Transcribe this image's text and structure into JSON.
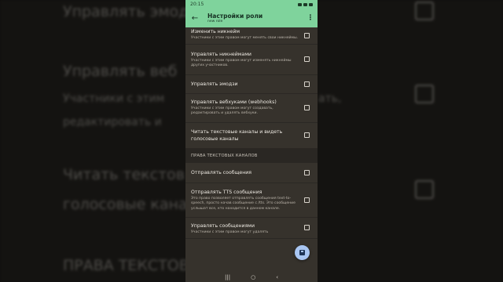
{
  "status_bar": {
    "time": "20:15"
  },
  "app_bar": {
    "back_icon": "arrow-left-icon",
    "title": "Настройки роли",
    "subtitle": "new role",
    "more_icon": "more-vertical-icon"
  },
  "permissions_top": [
    {
      "name": "Изменить никнейм",
      "desc": "Участники с этим правом могут менять свои никнеймы.",
      "checked": false
    },
    {
      "name": "Управлять никнеймами",
      "desc": "Участники с этим правом могут изменять никнеймы других участников.",
      "checked": false
    },
    {
      "name": "Управлять эмодзи",
      "desc": "",
      "checked": false
    },
    {
      "name": "Управлять вебхуками (webhooks)",
      "desc": "Участники с этим правом могут создавать, редактировать и удалять вебхуки.",
      "checked": false
    },
    {
      "name": "Читать текстовые каналы и видеть голосовые каналы",
      "desc": "",
      "checked": false
    }
  ],
  "section_text": "ПРАВА ТЕКСТОВЫХ КАНАЛОВ",
  "permissions_text": [
    {
      "name": "Отправлять сообщения",
      "desc": "",
      "checked": false
    },
    {
      "name": "Отправлять TTS сообщения",
      "desc": "Это право позволяет отправлять сообщения text-to-speech, просто начав сообщение с /tts. Это сообщение услышат все, кто находится в данном канале.",
      "checked": false
    },
    {
      "name": "Управлять сообщениями",
      "desc": "Участники с этим правом могут удалять",
      "checked": false
    }
  ],
  "fab": {
    "icon": "save-icon"
  },
  "background": {
    "lines": [
      "Управлять эмодз",
      "Управлять веб",
      "Участники с этим",
      "ать,",
      "редактировать и",
      "Читать текстов",
      "голосовые кана",
      "ПРАВА ТЕКСТОВ"
    ]
  },
  "colors": {
    "accent": "#7fd39c",
    "fab": "#a9c6f2",
    "surface": "#36322c"
  }
}
